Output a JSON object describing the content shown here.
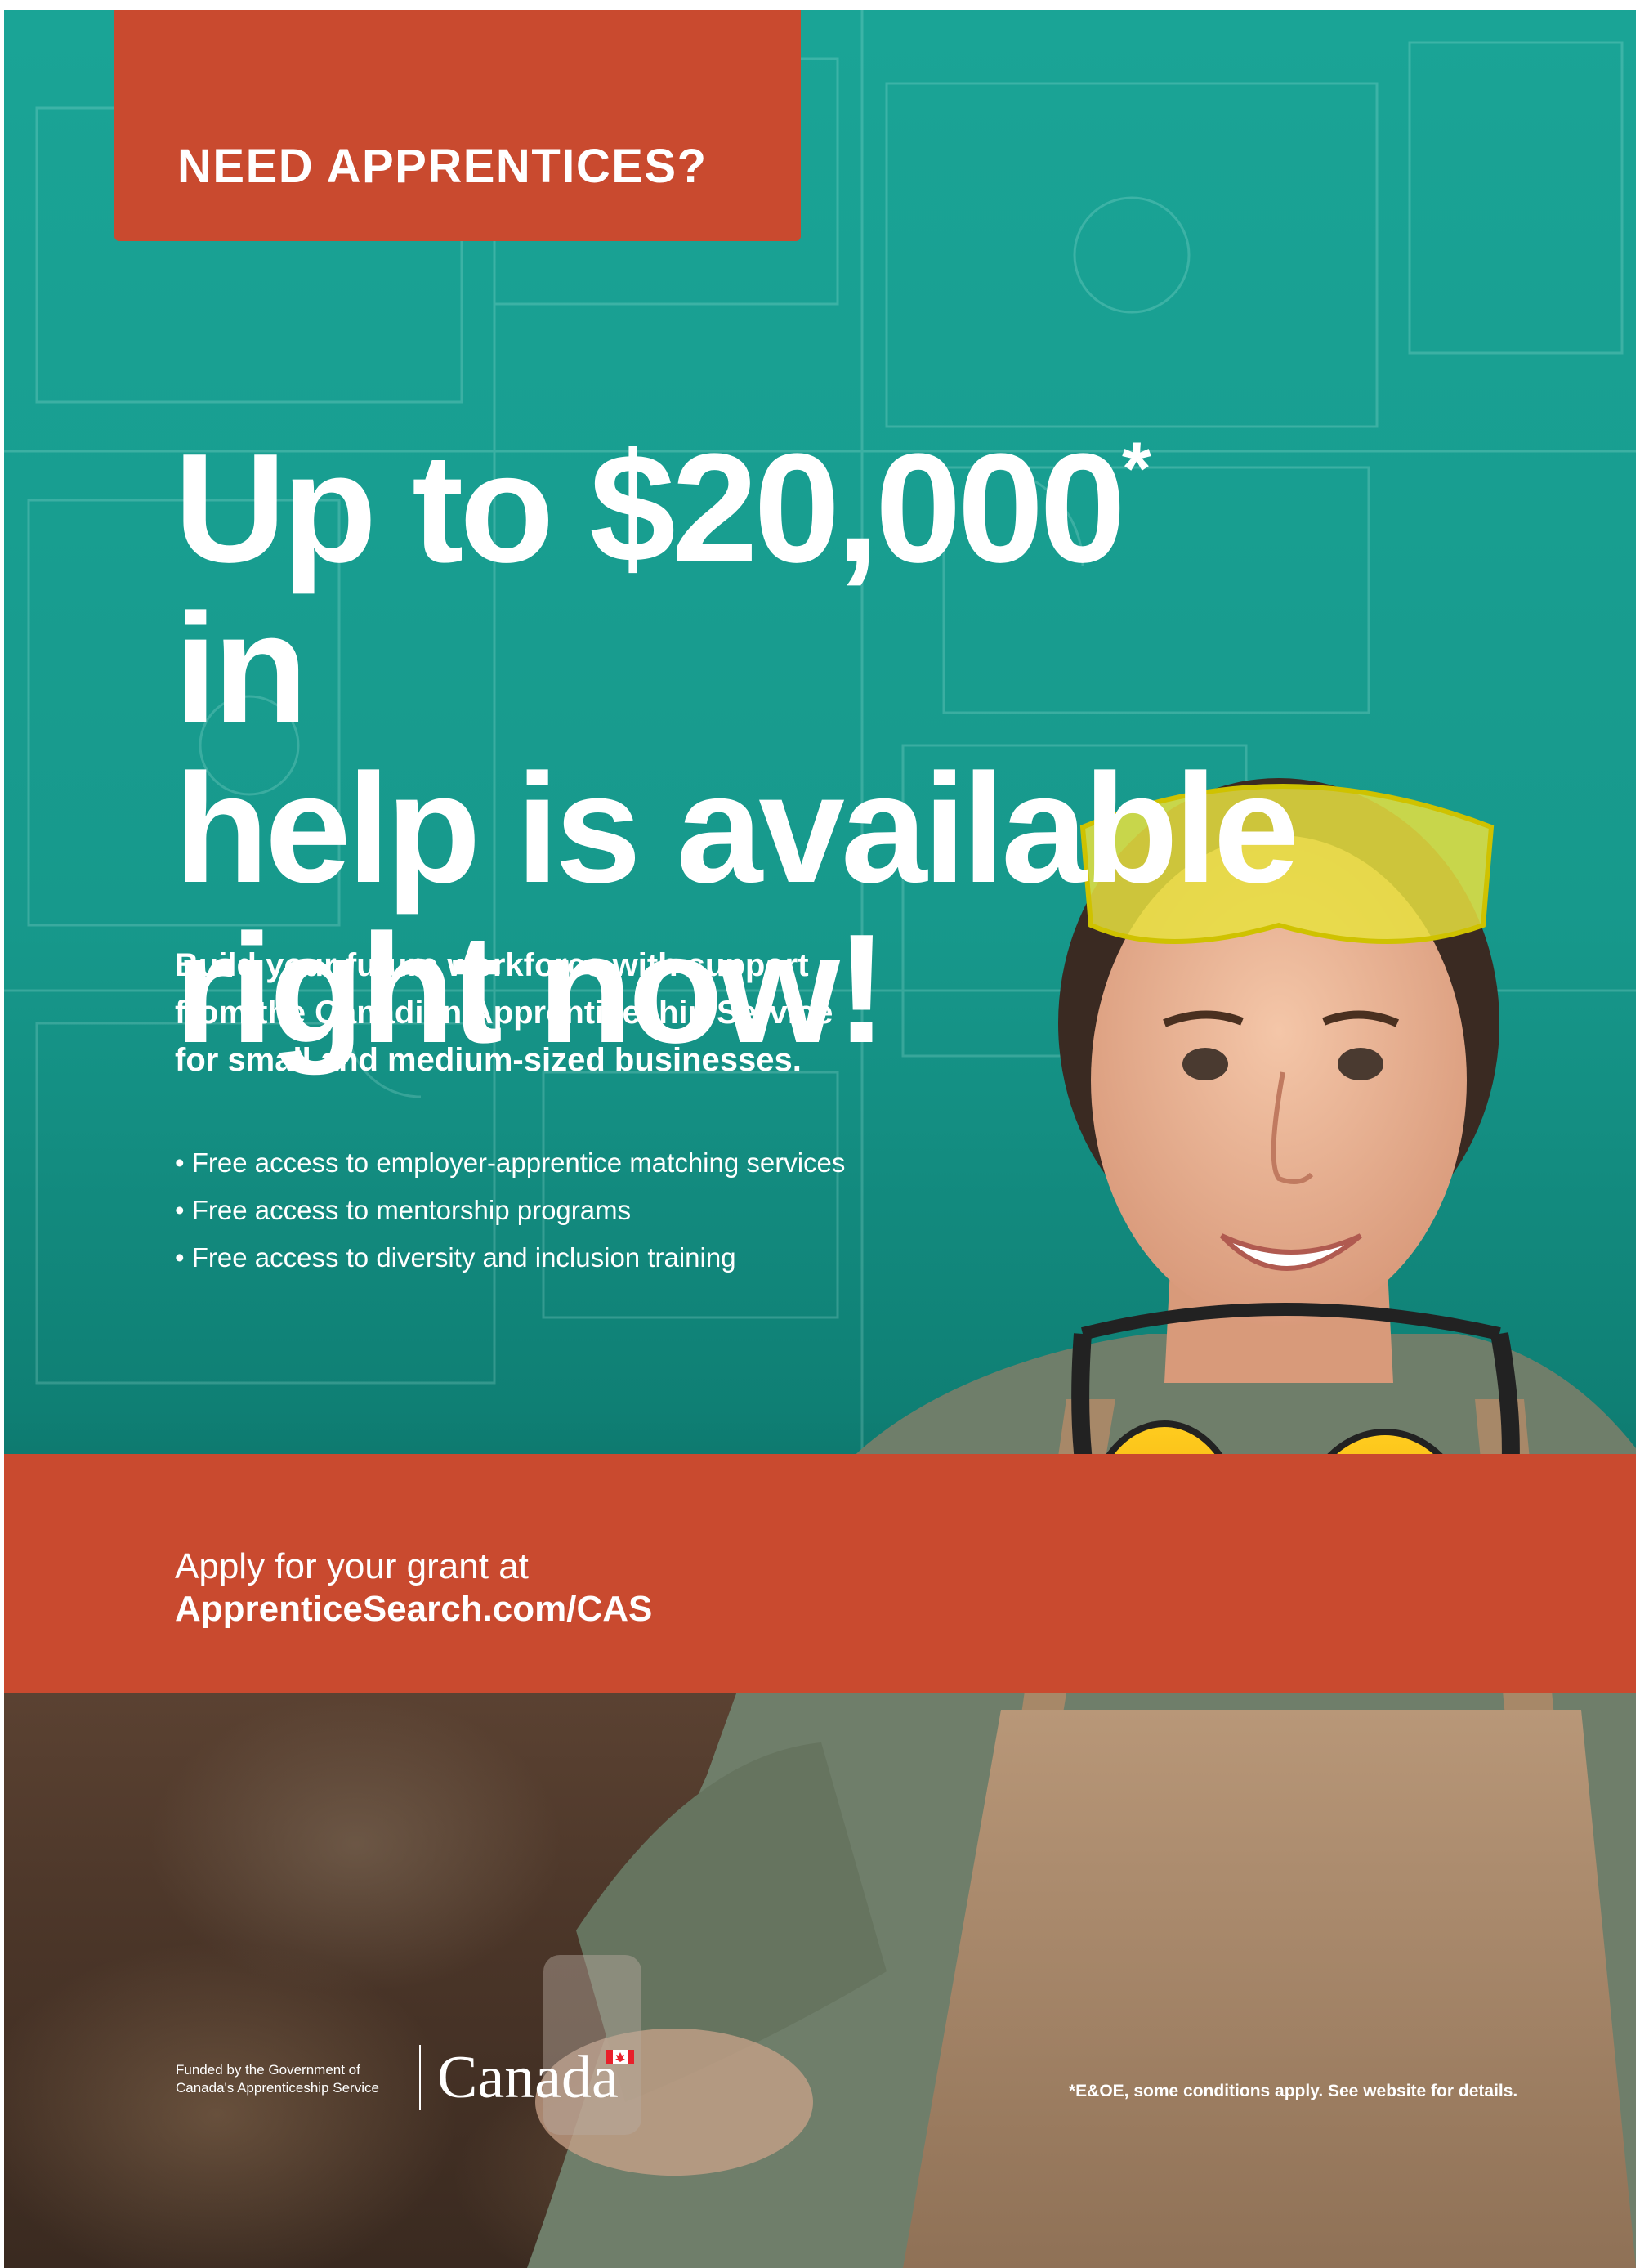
{
  "banner": {
    "label": "NEED APPRENTICES?"
  },
  "headline": {
    "line1_start": "Up to $20,000",
    "asterisk": "*",
    "line1_end": " in",
    "line2": "help is available",
    "line3": "right now!"
  },
  "subhead": {
    "line1": "Build your future workforce with support",
    "line2": "from the Canadian Apprenticeship Service",
    "line3": "for small and medium-sized businesses."
  },
  "benefits": [
    "Free access to employer-apprentice matching services",
    "Free access to mentorship programs",
    "Free access to diversity and inclusion training"
  ],
  "cta": {
    "line1": "Apply for your grant at",
    "url": "ApprenticeSearch.com/CAS"
  },
  "funding": {
    "line1": "Funded by the Government of",
    "line2": "Canada's Apprenticeship Service",
    "wordmark": "Canada"
  },
  "disclaimer": "*E&OE, some conditions apply. See website for details.",
  "colors": {
    "teal": "#1aa496",
    "banner_orange": "#c94a2f",
    "text": "#ffffff",
    "hardhat_yellow": "#f5b800",
    "apron": "#a9896b",
    "sweater": "#6f7e6a"
  },
  "icons": [
    "canada-flag-icon"
  ]
}
